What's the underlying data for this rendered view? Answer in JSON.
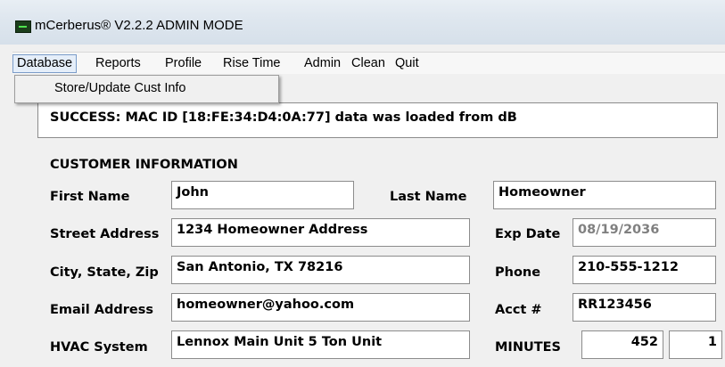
{
  "window": {
    "title": "mCerberus® V2.2.2 ADMIN MODE"
  },
  "menu": {
    "items": [
      "Database",
      "Reports",
      "Profile",
      "Rise Time",
      "Admin",
      "Clean",
      "Quit"
    ],
    "open_item": "Database",
    "dropdown_items": [
      "Store/Update Cust Info"
    ]
  },
  "status": {
    "message": "SUCCESS: MAC ID [18:FE:34:D4:0A:77] data was loaded from dB"
  },
  "customer": {
    "section_title": "CUSTOMER INFORMATION",
    "first_name_label": "First Name",
    "first_name": "John",
    "last_name_label": "Last Name",
    "last_name": "Homeowner",
    "street_label": "Street Address",
    "street": "1234 Homeowner Address",
    "exp_date_label": "Exp Date",
    "exp_date": "08/19/2036",
    "city_label": "City, State, Zip",
    "city": "San Antonio, TX  78216",
    "phone_label": "Phone",
    "phone": "210-555-1212",
    "email_label": "Email Address",
    "email": "homeowner@yahoo.com",
    "acct_label": "Acct #",
    "acct": "RR123456",
    "hvac_label": "HVAC System",
    "hvac": "Lennox Main Unit 5 Ton Unit",
    "minutes_label": "MINUTES",
    "minutes": "452",
    "minutes_extra": "1"
  },
  "colors": {
    "title_bar": "#dfe7ef",
    "window_bg": "#f0f0f0",
    "field_bg": "#ffffff",
    "disabled_text": "#808080"
  }
}
